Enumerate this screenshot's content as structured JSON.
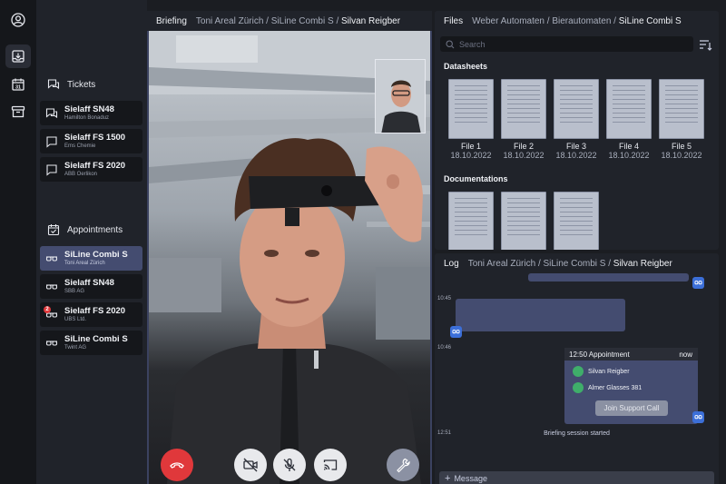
{
  "rail": {
    "icons": [
      "user-circle-icon",
      "inbox-download-icon",
      "calendar-icon",
      "archive-icon"
    ],
    "calendar_day": "31"
  },
  "sidebar": {
    "tickets": {
      "title": "Tickets",
      "items": [
        {
          "name": "Sielaff SN48",
          "sub": "Hamilton Bonaduz"
        },
        {
          "name": "Sielaff FS 1500",
          "sub": "Ems Chemie"
        },
        {
          "name": "Sielaff FS 2020",
          "sub": "ABB Oerlikon"
        }
      ]
    },
    "appointments": {
      "title": "Appointments",
      "items": [
        {
          "name": "SiLine Combi S",
          "sub": "Toni Areal Zürich",
          "selected": true
        },
        {
          "name": "Sielaff SN48",
          "sub": "SBB AG"
        },
        {
          "name": "Sielaff FS 2020",
          "sub": "UBS Ltd.",
          "badge": "2"
        },
        {
          "name": "SiLine Combi S",
          "sub": "Twint AG"
        }
      ]
    }
  },
  "briefing": {
    "title": "Briefing",
    "crumb_a": "Toni Areal Zürich",
    "crumb_b": "SiLine Combi S",
    "crumb_c": "Silvan Reigber",
    "sep": "/"
  },
  "files": {
    "title": "Files",
    "crumb_a": "Weber Automaten",
    "crumb_b": "Bierautomaten",
    "crumb_c": "SiLine Combi S",
    "sep": "/",
    "search_placeholder": "Search",
    "datasheets_title": "Datasheets",
    "datasheets": [
      {
        "name": "File 1",
        "date": "18.10.2022"
      },
      {
        "name": "File 2",
        "date": "18.10.2022"
      },
      {
        "name": "File 3",
        "date": "18.10.2022"
      },
      {
        "name": "File 4",
        "date": "18.10.2022"
      },
      {
        "name": "File 5",
        "date": "18.10.2022"
      }
    ],
    "documentations_title": "Documentations"
  },
  "log": {
    "title": "Log",
    "crumb_a": "Toni Areal Zürich",
    "crumb_b": "SiLine Combi S",
    "crumb_c": "Silvan Reigber",
    "sep": "/",
    "times": [
      "10:45",
      "10:46",
      "12:51"
    ],
    "appointment": {
      "title": "12:50 Appointment",
      "when": "now",
      "attendees": [
        "Silvan Reigber",
        "Almer Glasses 381"
      ],
      "join_label": "Join Support Call"
    },
    "system_message": "Briefing session started",
    "message_placeholder": "Message"
  },
  "colors": {
    "accent": "#444c70",
    "end_call": "#e0383b",
    "attendee": "#3fae6a",
    "avatar": "#3c6fd8"
  }
}
